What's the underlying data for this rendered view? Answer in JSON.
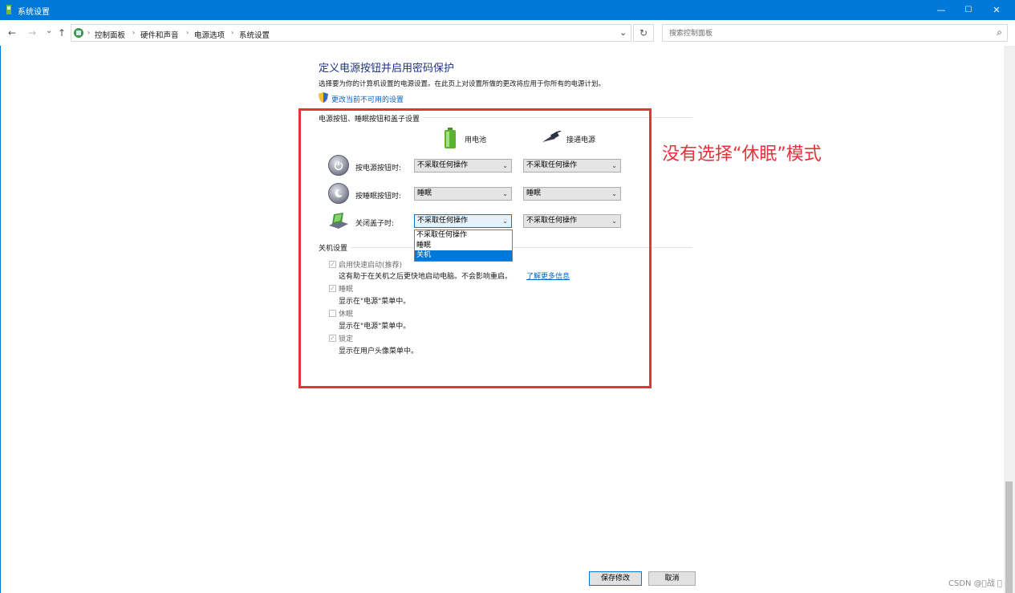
{
  "window": {
    "title": "系统设置",
    "controls": {
      "minimize": "—",
      "maximize": "☐",
      "close": "✕"
    }
  },
  "nav": {
    "back": "←",
    "forward": "→",
    "recent": "⌄",
    "up": "↑"
  },
  "breadcrumb": [
    "控制面板",
    "硬件和声音",
    "电源选项",
    "系统设置"
  ],
  "breadcrumb_sep": "›",
  "address_dropdown": "⌄",
  "refresh": "↻",
  "search": {
    "placeholder": "搜索控制面板",
    "icon": "⌕"
  },
  "page": {
    "title": "定义电源按钮并启用密码保护",
    "description": "选择要为你的计算机设置的电源设置。在此页上对设置所做的更改将应用于你所有的电源计划。",
    "change_link": "更改当前不可用的设置"
  },
  "power_section": {
    "title": "电源按钮、睡眠按钮和盖子设置",
    "col_battery": "用电池",
    "col_plugged": "接通电源",
    "rows": [
      {
        "label": "按电源按钮时:",
        "battery": "不采取任何操作",
        "plugged": "不采取任何操作"
      },
      {
        "label": "按睡眠按钮时:",
        "battery": "睡眠",
        "plugged": "睡眠"
      },
      {
        "label": "关闭盖子时:",
        "battery": "不采取任何操作",
        "plugged": "不采取任何操作"
      }
    ],
    "dropdown_options": [
      "不采取任何操作",
      "睡眠",
      "关机"
    ],
    "dropdown_highlighted": "关机"
  },
  "shutdown_section": {
    "title": "关机设置",
    "items": [
      {
        "label": "启用快速启动(推荐)",
        "desc": "这有助于在关机之后更快地启动电脑。不会影响重启。",
        "link": "了解更多信息",
        "checked": true
      },
      {
        "label": "睡眠",
        "desc": "显示在\"电源\"菜单中。",
        "checked": true
      },
      {
        "label": "休眠",
        "desc": "显示在\"电源\"菜单中。",
        "checked": false
      },
      {
        "label": "锁定",
        "desc": "显示在用户头像菜单中。",
        "checked": true
      }
    ]
  },
  "buttons": {
    "save": "保存修改",
    "cancel": "取消"
  },
  "annotation": "没有选择“休眠”模式",
  "watermark": "CSDN @\u0000战 \u0000",
  "colors": {
    "titlebar": "#0078d7",
    "annotation": "#e5323b",
    "link": "#0066cc",
    "heading": "#1e3287"
  }
}
